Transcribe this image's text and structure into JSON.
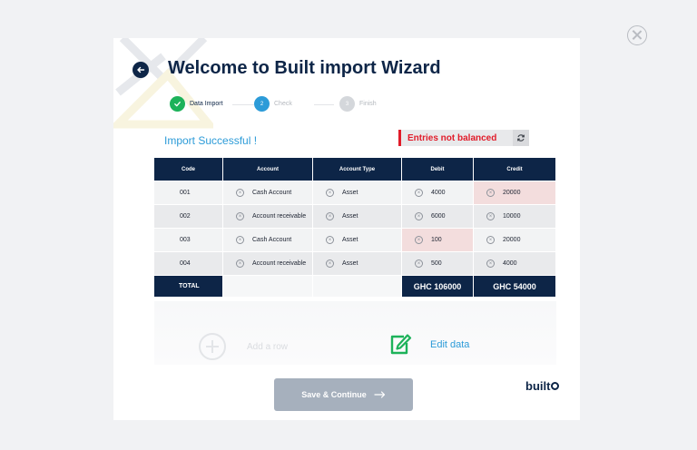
{
  "wizard": {
    "title": "Welcome to Built import Wizard",
    "steps": [
      {
        "label": "Data Import",
        "state": "done"
      },
      {
        "number": "2",
        "label": "Check",
        "state": "active"
      },
      {
        "number": "3",
        "label": "Finish",
        "state": "pending"
      }
    ],
    "status_message": "Import Successful !",
    "balance_badge": "Entries not balanced"
  },
  "table": {
    "columns": [
      "Code",
      "Account",
      "Account Type",
      "Debit",
      "Credit"
    ],
    "rows": [
      {
        "code": "001",
        "account": "Cash Account",
        "type": "Asset",
        "debit": "4000",
        "credit": "20000",
        "invalid": [
          "credit"
        ]
      },
      {
        "code": "002",
        "account": "Account receivable",
        "type": "Asset",
        "debit": "6000",
        "credit": "10000",
        "invalid": []
      },
      {
        "code": "003",
        "account": "Cash Account",
        "type": "Asset",
        "debit": "100",
        "credit": "20000",
        "invalid": [
          "debit"
        ]
      },
      {
        "code": "004",
        "account": "Account receivable",
        "type": "Asset",
        "debit": "500",
        "credit": "4000",
        "invalid": []
      }
    ],
    "total_label": "TOTAL",
    "total_debit": "GHC 106000",
    "total_credit": "GHC 54000"
  },
  "actions": {
    "add_row": "Add a row",
    "edit_data": "Edit data",
    "save_continue": "Save & Continue"
  },
  "brand": {
    "logo_text": "built"
  },
  "colors": {
    "navy": "#0d2547",
    "accent_blue": "#2c9bd8",
    "success_green": "#1db25a",
    "error_red": "#e11c2a",
    "invalid_cell": "#f3dddd"
  },
  "icons": {
    "back": "arrow-left-icon",
    "close": "close-circle-icon",
    "refresh": "refresh-icon",
    "cell_clear": "x-circle-icon",
    "add": "plus-circle-icon",
    "edit": "edit-icon",
    "continue": "arrow-right-icon"
  }
}
